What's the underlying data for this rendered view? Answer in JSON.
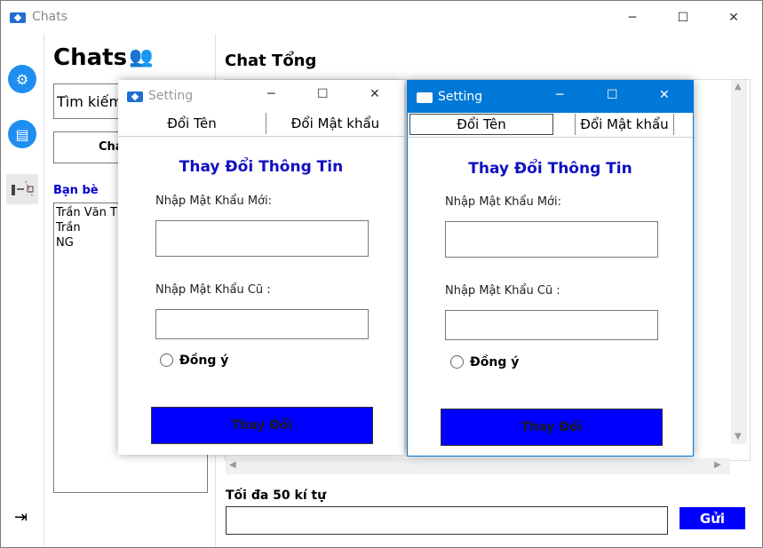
{
  "window": {
    "title": "Chats"
  },
  "rail": {
    "settings_icon": "gear-icon",
    "chat_icon": "chat-icon",
    "friends_icon": "group-icon",
    "logout_icon": "logout-icon"
  },
  "left": {
    "title": "Chats",
    "search_value": "Tìm kiếm",
    "button_label": "Cha",
    "friends_label": "Bạn bè",
    "friends": [
      "Trần Văn T",
      "Trần",
      "NG"
    ]
  },
  "main": {
    "title": "Chat Tổng",
    "limit_label": "Tối đa 50 kí tự",
    "message_value": "",
    "send_label": "Gửi"
  },
  "dialogs": [
    {
      "title": "Setting",
      "active": false,
      "tabs": [
        "Đổi Tên",
        "Đổi Mật khẩu"
      ],
      "heading": "Thay Đổi Thông Tin",
      "new_pass_label": "Nhập Mật Khẩu Mới:",
      "old_pass_label": "Nhập Mật Khẩu Cũ :",
      "agree_label": "Đồng ý",
      "submit_label": "Thay Đổi"
    },
    {
      "title": "Setting",
      "active": true,
      "tabs": [
        "Đổi Tên",
        "Đổi Mật khẩu"
      ],
      "heading": "Thay Đổi Thông Tin",
      "new_pass_label": "Nhập Mật Khẩu Mới:",
      "old_pass_label": "Nhập Mật Khẩu Cũ :",
      "agree_label": "Đồng ý",
      "submit_label": "Thay Đổi"
    }
  ],
  "colors": {
    "accent_blue": "#0078d7",
    "button_blue": "#0000ff",
    "heading_blue": "#1010c0"
  }
}
